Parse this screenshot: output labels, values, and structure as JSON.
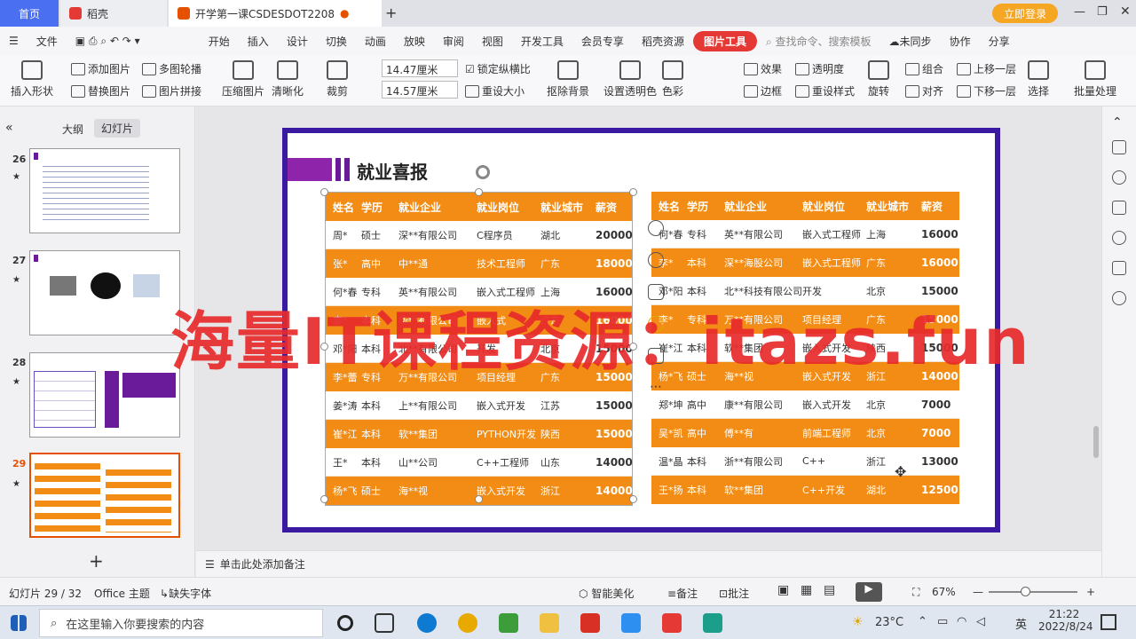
{
  "tabs": {
    "home": "首页",
    "t1": "稻壳",
    "t2": "开学第一课CSDESDOT2208"
  },
  "window": {
    "login": "立即登录"
  },
  "menu": {
    "file": "文件",
    "items": [
      "开始",
      "插入",
      "设计",
      "切换",
      "动画",
      "放映",
      "审阅",
      "视图",
      "开发工具",
      "会员专享",
      "稻壳资源"
    ],
    "active": "图片工具",
    "search": "查找命令、搜索模板",
    "sync": "未同步",
    "collab": "协作",
    "share": "分享"
  },
  "ribbon": {
    "insert_shape": "插入形状",
    "add_img": "添加图片",
    "multi_carousel": "多图轮播",
    "replace_img": "替换图片",
    "img_splice": "图片拼接",
    "compress": "压缩图片",
    "sharpen": "清晰化",
    "crop": "裁剪",
    "width": "14.47厘米",
    "height": "14.57厘米",
    "lock_ratio": "锁定纵横比",
    "reset_size": "重设大小",
    "remove_bg": "抠除背景",
    "set_transparent": "设置透明色",
    "color": "色彩",
    "effect": "效果",
    "border": "边框",
    "transparency": "透明度",
    "reset_style": "重设样式",
    "rotate": "旋转",
    "group": "组合",
    "align": "对齐",
    "bring_forward": "上移一层",
    "send_backward": "下移一层",
    "select": "选择",
    "batch": "批量处理"
  },
  "pane": {
    "outline": "大纲",
    "slides": "幻灯片",
    "thumbs": [
      "26",
      "27",
      "28",
      "29"
    ],
    "star": "★",
    "add": "+"
  },
  "slide": {
    "title": "就业喜报",
    "headers": [
      "姓名",
      "学历",
      "就业企业",
      "就业岗位",
      "就业城市",
      "薪资"
    ],
    "left": [
      [
        "周*",
        "硕士",
        "深**有限公司",
        "C程序员",
        "湖北",
        "20000"
      ],
      [
        "张*",
        "高中",
        "中**通",
        "技术工程师",
        "广东",
        "18000"
      ],
      [
        "何*春",
        "专科",
        "英**有限公司",
        "嵌入式工程师",
        "上海",
        "16000"
      ],
      [
        "李*",
        "本科",
        "华**有限公司",
        "嵌入式",
        "广东",
        "16000"
      ],
      [
        "邓*阳",
        "本科",
        "北**有限公司",
        "开发",
        "北京",
        "15000"
      ],
      [
        "李*蕾",
        "专科",
        "万**有限公司",
        "项目经理",
        "广东",
        "15000"
      ],
      [
        "姜*涛",
        "本科",
        "上**有限公司",
        "嵌入式开发",
        "江苏",
        "15000"
      ],
      [
        "崔*江",
        "本科",
        "软**集团",
        "PYTHON开发",
        "陕西",
        "15000"
      ],
      [
        "王*",
        "本科",
        "山**公司",
        "C++工程师",
        "山东",
        "14000"
      ],
      [
        "杨*飞",
        "硕士",
        "海**视",
        "嵌入式开发",
        "浙江",
        "14000"
      ]
    ],
    "right": [
      [
        "何*春",
        "专科",
        "英**有限公司",
        "嵌入式工程师",
        "上海",
        "16000"
      ],
      [
        "李*",
        "本科",
        "深**海股公司",
        "嵌入式工程师",
        "广东",
        "16000"
      ],
      [
        "邓*阳",
        "本科",
        "北**科技有限公司",
        "开发",
        "北京",
        "15000"
      ],
      [
        "李*",
        "专科",
        "万**有限公司",
        "项目经理",
        "广东",
        "15000"
      ],
      [
        "崔*江",
        "本科",
        "软**集团",
        "嵌入式开发",
        "陕西",
        "15000"
      ],
      [
        "杨*飞",
        "硕士",
        "海**视",
        "嵌入式开发",
        "浙江",
        "14000"
      ],
      [
        "郑*坤",
        "高中",
        "康**有限公司",
        "嵌入式开发",
        "北京",
        "7000"
      ],
      [
        "吴*凯",
        "高中",
        "傅**有",
        "前端工程师",
        "北京",
        "7000"
      ],
      [
        "温*晶",
        "本科",
        "浙**有限公司",
        "C++",
        "浙江",
        "13000"
      ],
      [
        "王*扬",
        "本科",
        "软**集团",
        "C++开发",
        "湖北",
        "12500"
      ]
    ]
  },
  "watermark": "海量IT课程资源：itazs.fun",
  "notes": "单击此处添加备注",
  "status": {
    "slide": "幻灯片 29 / 32",
    "theme": "Office 主题",
    "font": "缺失字体",
    "beautify": "智能美化",
    "notes": "备注",
    "comment": "批注",
    "zoom": "67%"
  },
  "taskbar": {
    "search": "在这里输入你要搜索的内容",
    "temp": "23°C",
    "lang": "英",
    "time": "21:22",
    "date": "2022/8/24"
  },
  "colors": {
    "accent": "#f28c14",
    "frame": "#3a1aa0",
    "watermark": "#e82b2b"
  }
}
